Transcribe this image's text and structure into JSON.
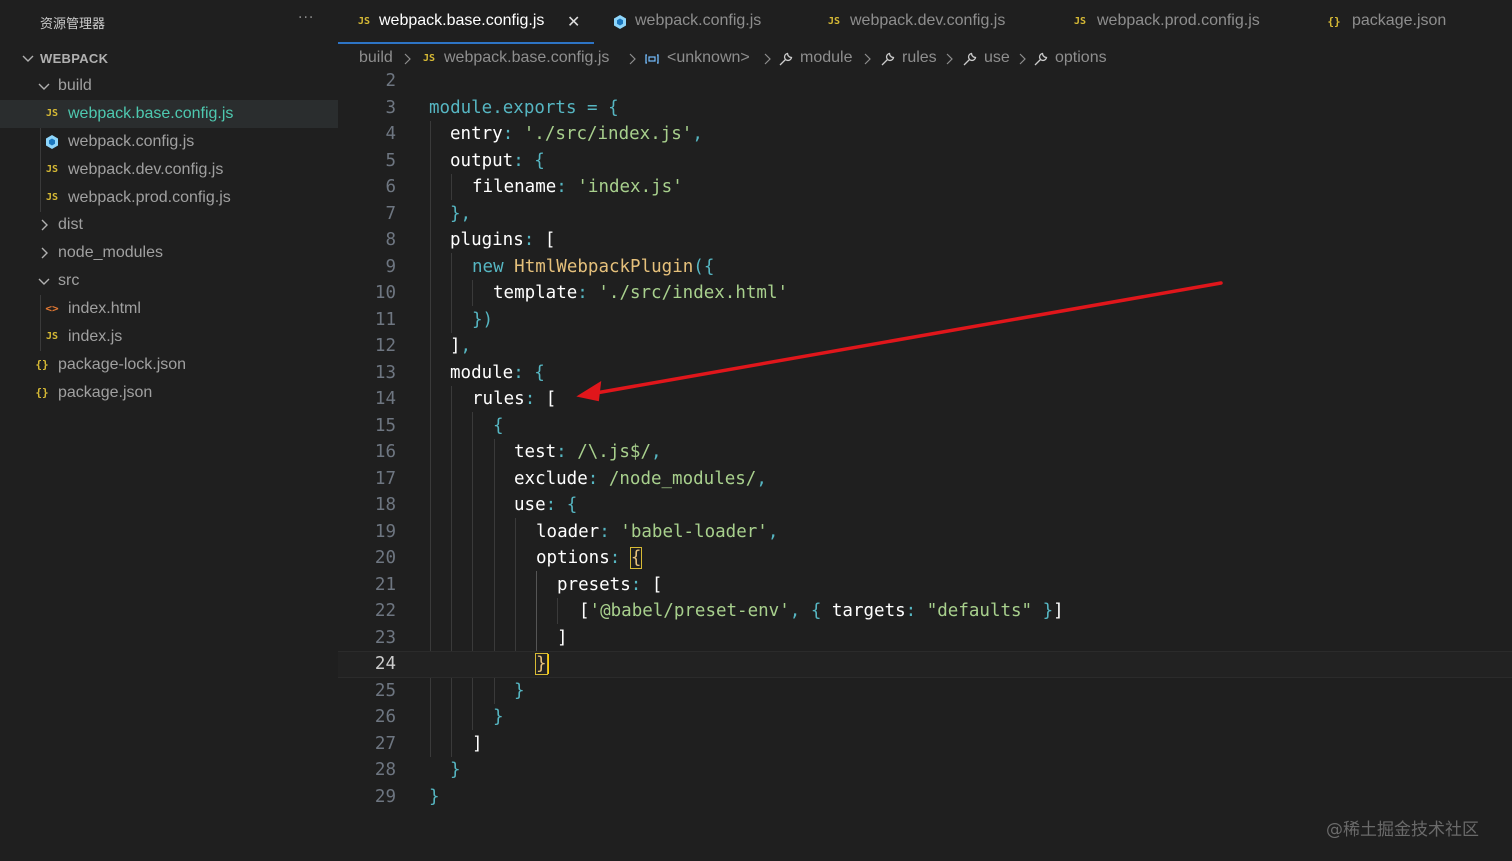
{
  "sidebar": {
    "title": "资源管理器",
    "more": "···",
    "root": "WEBPACK",
    "items": [
      {
        "label": "build",
        "type": "folder",
        "expanded": true
      },
      {
        "label": "webpack.base.config.js",
        "type": "js",
        "selected": true
      },
      {
        "label": "webpack.config.js",
        "type": "webpack"
      },
      {
        "label": "webpack.dev.config.js",
        "type": "js"
      },
      {
        "label": "webpack.prod.config.js",
        "type": "js"
      },
      {
        "label": "dist",
        "type": "folder",
        "expanded": false
      },
      {
        "label": "node_modules",
        "type": "folder",
        "expanded": false
      },
      {
        "label": "src",
        "type": "folder",
        "expanded": true
      },
      {
        "label": "index.html",
        "type": "html"
      },
      {
        "label": "index.js",
        "type": "js"
      },
      {
        "label": "package-lock.json",
        "type": "json"
      },
      {
        "label": "package.json",
        "type": "json"
      }
    ]
  },
  "tabs": [
    {
      "label": "webpack.base.config.js",
      "icon": "JS",
      "active": true,
      "close": "✕"
    },
    {
      "label": "webpack.config.js",
      "icon": "webpack"
    },
    {
      "label": "webpack.dev.config.js",
      "icon": "JS"
    },
    {
      "label": "webpack.prod.config.js",
      "icon": "JS"
    },
    {
      "label": "package.json",
      "icon": "{}"
    }
  ],
  "icons": {
    "js": "JS",
    "json": "{}",
    "html": "<>"
  },
  "breadcrumb": [
    "build",
    "webpack.base.config.js",
    "<unknown>",
    "module",
    "rules",
    "use",
    "options"
  ],
  "editor": {
    "current_line": 24,
    "lines": [
      {
        "n": "2"
      },
      {
        "n": "3"
      },
      {
        "n": "4"
      },
      {
        "n": "5"
      },
      {
        "n": "6"
      },
      {
        "n": "7"
      },
      {
        "n": "8"
      },
      {
        "n": "9"
      },
      {
        "n": "10"
      },
      {
        "n": "11"
      },
      {
        "n": "12"
      },
      {
        "n": "13"
      },
      {
        "n": "14"
      },
      {
        "n": "15"
      },
      {
        "n": "16"
      },
      {
        "n": "17"
      },
      {
        "n": "18"
      },
      {
        "n": "19"
      },
      {
        "n": "20"
      },
      {
        "n": "21"
      },
      {
        "n": "22"
      },
      {
        "n": "23"
      },
      {
        "n": "24"
      },
      {
        "n": "25"
      },
      {
        "n": "26"
      },
      {
        "n": "27"
      },
      {
        "n": "28"
      },
      {
        "n": "29"
      }
    ],
    "code": {
      "l3a": "module.exports",
      "l3b": " = ",
      "l3c": "{",
      "l4a": "entry",
      "l4b": ": ",
      "l4c": "'./src/index.js'",
      "l4d": ",",
      "l5a": "output",
      "l5b": ": ",
      "l5c": "{",
      "l6a": "filename",
      "l6b": ": ",
      "l6c": "'index.js'",
      "l7a": "}",
      "l7b": ",",
      "l8a": "plugins",
      "l8b": ": ",
      "l8c": "[",
      "l9a": "new ",
      "l9b": "HtmlWebpackPlugin",
      "l9c": "(",
      "l9d": "{",
      "l10a": "template",
      "l10b": ": ",
      "l10c": "'./src/index.html'",
      "l11a": "}",
      "l11b": ")",
      "l12a": "]",
      "l12b": ",",
      "l13a": "module",
      "l13b": ": ",
      "l13c": "{",
      "l14a": "rules",
      "l14b": ": ",
      "l14c": "[",
      "l15a": "{",
      "l16a": "test",
      "l16b": ": ",
      "l16c": "/\\.js$/",
      "l16d": ",",
      "l17a": "exclude",
      "l17b": ": ",
      "l17c": "/node_modules/",
      "l17d": ",",
      "l18a": "use",
      "l18b": ": ",
      "l18c": "{",
      "l19a": "loader",
      "l19b": ": ",
      "l19c": "'babel-loader'",
      "l19d": ",",
      "l20a": "options",
      "l20b": ": ",
      "l20c": "{",
      "l21a": "presets",
      "l21b": ": ",
      "l21c": "[",
      "l22a": "[",
      "l22b": "'@babel/preset-env'",
      "l22c": ", ",
      "l22d": "{ ",
      "l22e": "targets",
      "l22f": ": ",
      "l22g": "\"defaults\"",
      "l22h": " }",
      "l22i": "]",
      "l23a": "]",
      "l24a": "}",
      "l25a": "}",
      "l26a": "}",
      "l27a": "]",
      "l28a": "}",
      "l29a": "}"
    }
  },
  "annotation_arrow": {
    "color": "#e0161b"
  },
  "watermark": "@稀土掘金技术社区",
  "colors": {
    "accent": "#2d74c5",
    "selected_file": "#4ec9b0",
    "js_icon": "#d7ba35"
  }
}
